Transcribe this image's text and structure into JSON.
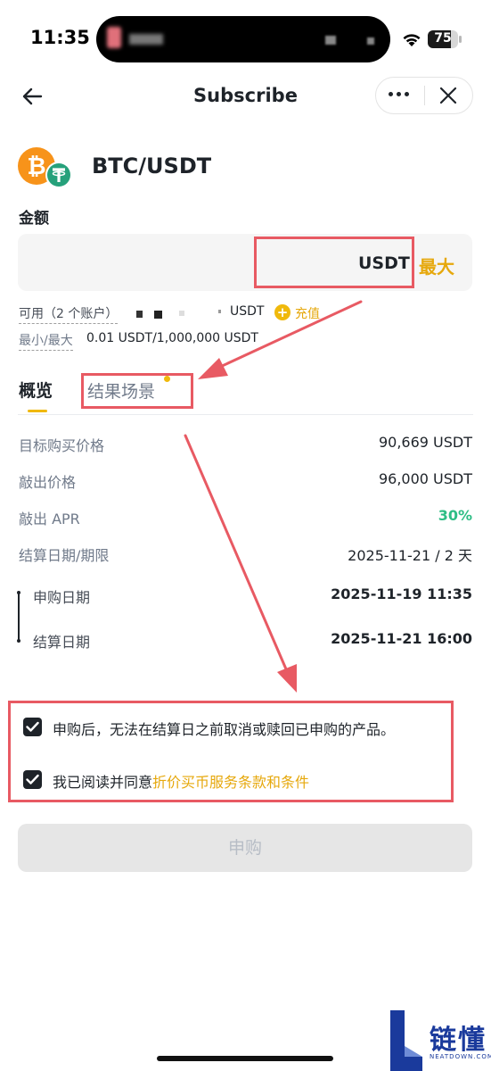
{
  "status_bar": {
    "time": "11:35",
    "battery_level": 75,
    "battery_text": "75"
  },
  "nav": {
    "title": "Subscribe"
  },
  "pair": {
    "name": "BTC/USDT",
    "base_icon": "bitcoin-icon",
    "quote_icon": "tether-icon"
  },
  "amount": {
    "label": "金额",
    "unit": "USDT",
    "max_label": "最大"
  },
  "available": {
    "label": "可用（2 个账户）",
    "unit": "USDT",
    "deposit_label": "充值"
  },
  "minmax": {
    "label": "最小/最大",
    "value": "0.01 USDT/1,000,000 USDT"
  },
  "tabs": [
    {
      "label": "概览",
      "active": true
    },
    {
      "label": "结果场景",
      "active": false,
      "badge": true
    }
  ],
  "details": [
    {
      "label": "目标购买价格",
      "value": "90,669 USDT"
    },
    {
      "label": "敲出价格",
      "value": "96,000 USDT"
    },
    {
      "label": "敲出 APR",
      "value": "30%"
    },
    {
      "label": "结算日期/期限",
      "value": "2025-11-21 / 2 天"
    }
  ],
  "timeline": [
    {
      "label": "申购日期",
      "value": "2025-11-19 11:35"
    },
    {
      "label": "结算日期",
      "value": "2025-11-21 16:00"
    }
  ],
  "checkboxes": [
    {
      "text": "申购后，无法在结算日之前取消或赎回已申购的产品。",
      "checked": true
    },
    {
      "text": "我已阅读并同意",
      "link": "折价买币服务条款和条件",
      "checked": true
    }
  ],
  "submit": {
    "label": "申购"
  },
  "watermark": {
    "text": "链懂",
    "sub": "NEATDOWN.COM"
  },
  "colors": {
    "accent": "#F0B90B",
    "link": "#E6A80C",
    "positive": "#2EBD85",
    "annotation": "#E85A63"
  }
}
